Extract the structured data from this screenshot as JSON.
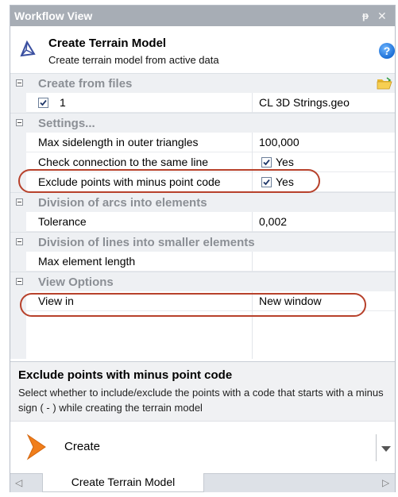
{
  "window": {
    "title": "Workflow View"
  },
  "header": {
    "title": "Create Terrain Model",
    "subtitle": "Create terrain model from active data",
    "help_glyph": "?"
  },
  "grid": {
    "categories": [
      {
        "label": "Create from files"
      },
      {
        "label": "Settings..."
      },
      {
        "label": "Division of arcs into elements"
      },
      {
        "label": "Division of lines into smaller elements"
      },
      {
        "label": "View Options"
      }
    ],
    "file_row": {
      "name": "1",
      "value": "CL 3D Strings.geo",
      "checked": true
    },
    "settings": [
      {
        "name": "Max sidelength in outer triangles",
        "value": "100,000"
      },
      {
        "name": "Check connection to the same line",
        "value": "Yes",
        "checked": true
      },
      {
        "name": "Exclude points with minus point code",
        "value": "Yes",
        "checked": true
      }
    ],
    "arcs": {
      "name": "Tolerance",
      "value": "0,002"
    },
    "lines": {
      "name": "Max element length",
      "value": ""
    },
    "view": {
      "name": "View in",
      "value": "New window"
    }
  },
  "description": {
    "title": "Exclude points with minus point code",
    "body": "Select whether to include/exclude the points with a code that starts with a minus sign ( - ) while creating the terrain model"
  },
  "actions": {
    "create_label": "Create"
  },
  "tabs": {
    "active": "Create Terrain Model"
  },
  "colors": {
    "highlight": "#b7412b",
    "arrow": "#f07e1b",
    "titlebar": "#a7adb5"
  },
  "icons": [
    "pin-icon",
    "close-icon",
    "terrain-model-icon",
    "help-icon",
    "open-folder-icon",
    "create-arrow-icon",
    "dropdown-arrow-icon",
    "scroll-left-icon",
    "scroll-right-icon"
  ]
}
